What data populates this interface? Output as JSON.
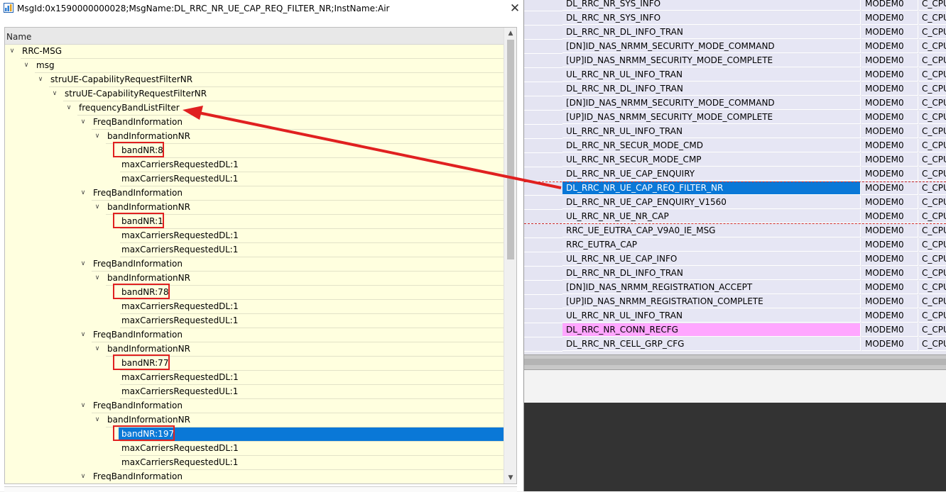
{
  "dialog": {
    "title": "MsgId:0x1590000000028;MsgName:DL_RRC_NR_UE_CAP_REQ_FILTER_NR;InstName:Air",
    "close_glyph": "✕",
    "column_header": "Name",
    "tree": [
      {
        "label": "RRC-MSG",
        "level": 0,
        "expanded": true
      },
      {
        "label": "msg",
        "level": 1,
        "expanded": true
      },
      {
        "label": "struUE-CapabilityRequestFilterNR",
        "level": 2,
        "expanded": true
      },
      {
        "label": "struUE-CapabilityRequestFilterNR",
        "level": 3,
        "expanded": true
      },
      {
        "label": "frequencyBandListFilter",
        "level": 4,
        "expanded": true
      },
      {
        "label": "FreqBandInformation",
        "level": 5,
        "expanded": true
      },
      {
        "label": "bandInformationNR",
        "level": 6,
        "expanded": true
      },
      {
        "label": "bandNR:8",
        "level": 7,
        "boxed": true
      },
      {
        "label": "maxCarriersRequestedDL:1",
        "level": 7
      },
      {
        "label": "maxCarriersRequestedUL:1",
        "level": 7
      },
      {
        "label": "FreqBandInformation",
        "level": 5,
        "expanded": true
      },
      {
        "label": "bandInformationNR",
        "level": 6,
        "expanded": true
      },
      {
        "label": "bandNR:1",
        "level": 7,
        "boxed": true
      },
      {
        "label": "maxCarriersRequestedDL:1",
        "level": 7
      },
      {
        "label": "maxCarriersRequestedUL:1",
        "level": 7
      },
      {
        "label": "FreqBandInformation",
        "level": 5,
        "expanded": true
      },
      {
        "label": "bandInformationNR",
        "level": 6,
        "expanded": true
      },
      {
        "label": "bandNR:78",
        "level": 7,
        "boxed": true
      },
      {
        "label": "maxCarriersRequestedDL:1",
        "level": 7
      },
      {
        "label": "maxCarriersRequestedUL:1",
        "level": 7
      },
      {
        "label": "FreqBandInformation",
        "level": 5,
        "expanded": true
      },
      {
        "label": "bandInformationNR",
        "level": 6,
        "expanded": true
      },
      {
        "label": "bandNR:77",
        "level": 7,
        "boxed": true
      },
      {
        "label": "maxCarriersRequestedDL:1",
        "level": 7
      },
      {
        "label": "maxCarriersRequestedUL:1",
        "level": 7
      },
      {
        "label": "FreqBandInformation",
        "level": 5,
        "expanded": true
      },
      {
        "label": "bandInformationNR",
        "level": 6,
        "expanded": true
      },
      {
        "label": "bandNR:197",
        "level": 7,
        "boxed": true,
        "selected": true
      },
      {
        "label": "maxCarriersRequestedDL:1",
        "level": 7
      },
      {
        "label": "maxCarriersRequestedUL:1",
        "level": 7
      },
      {
        "label": "FreqBandInformation",
        "level": 5,
        "expanded": true
      }
    ]
  },
  "message_list": {
    "rows": [
      {
        "name": "DL_RRC_NR_SYS_INFO",
        "modem": "MODEM0",
        "cpu": "C_CPU"
      },
      {
        "name": "DL_RRC_NR_SYS_INFO",
        "modem": "MODEM0",
        "cpu": "C_CPU"
      },
      {
        "name": "DL_RRC_NR_DL_INFO_TRAN",
        "modem": "MODEM0",
        "cpu": "C_CPU"
      },
      {
        "name": "[DN]ID_NAS_NRMM_SECURITY_MODE_COMMAND",
        "modem": "MODEM0",
        "cpu": "C_CPU"
      },
      {
        "name": "[UP]ID_NAS_NRMM_SECURITY_MODE_COMPLETE",
        "modem": "MODEM0",
        "cpu": "C_CPU"
      },
      {
        "name": "UL_RRC_NR_UL_INFO_TRAN",
        "modem": "MODEM0",
        "cpu": "C_CPU"
      },
      {
        "name": "DL_RRC_NR_DL_INFO_TRAN",
        "modem": "MODEM0",
        "cpu": "C_CPU"
      },
      {
        "name": "[DN]ID_NAS_NRMM_SECURITY_MODE_COMMAND",
        "modem": "MODEM0",
        "cpu": "C_CPU"
      },
      {
        "name": "[UP]ID_NAS_NRMM_SECURITY_MODE_COMPLETE",
        "modem": "MODEM0",
        "cpu": "C_CPU"
      },
      {
        "name": "UL_RRC_NR_UL_INFO_TRAN",
        "modem": "MODEM0",
        "cpu": "C_CPU"
      },
      {
        "name": "DL_RRC_NR_SECUR_MODE_CMD",
        "modem": "MODEM0",
        "cpu": "C_CPU"
      },
      {
        "name": "UL_RRC_NR_SECUR_MODE_CMP",
        "modem": "MODEM0",
        "cpu": "C_CPU"
      },
      {
        "name": "DL_RRC_NR_UE_CAP_ENQUIRY",
        "modem": "MODEM0",
        "cpu": "C_CPU"
      },
      {
        "name": "DL_RRC_NR_UE_CAP_REQ_FILTER_NR",
        "modem": "MODEM0",
        "cpu": "C_CPU",
        "selected": true
      },
      {
        "name": "DL_RRC_NR_UE_CAP_ENQUIRY_V1560",
        "modem": "MODEM0",
        "cpu": "C_CPU"
      },
      {
        "name": "UL_RRC_NR_UE_NR_CAP",
        "modem": "MODEM0",
        "cpu": "C_CPU"
      },
      {
        "name": "RRC_UE_EUTRA_CAP_V9A0_IE_MSG",
        "modem": "MODEM0",
        "cpu": "C_CPU"
      },
      {
        "name": "RRC_EUTRA_CAP",
        "modem": "MODEM0",
        "cpu": "C_CPU"
      },
      {
        "name": "UL_RRC_NR_UE_CAP_INFO",
        "modem": "MODEM0",
        "cpu": "C_CPU"
      },
      {
        "name": "DL_RRC_NR_DL_INFO_TRAN",
        "modem": "MODEM0",
        "cpu": "C_CPU"
      },
      {
        "name": "[DN]ID_NAS_NRMM_REGISTRATION_ACCEPT",
        "modem": "MODEM0",
        "cpu": "C_CPU"
      },
      {
        "name": "[UP]ID_NAS_NRMM_REGISTRATION_COMPLETE",
        "modem": "MODEM0",
        "cpu": "C_CPU"
      },
      {
        "name": "UL_RRC_NR_UL_INFO_TRAN",
        "modem": "MODEM0",
        "cpu": "C_CPU"
      },
      {
        "name": "DL_RRC_NR_CONN_RECFG",
        "modem": "MODEM0",
        "cpu": "C_CPU",
        "highlight": "pink"
      },
      {
        "name": "DL_RRC_NR_CELL_GRP_CFG",
        "modem": "MODEM0",
        "cpu": "C_CPU"
      }
    ]
  },
  "colors": {
    "selection": "#0a78d7",
    "pink_highlight": "#ffa6ff",
    "annotation_red": "#e02020",
    "tree_background": "#ffffdf"
  }
}
